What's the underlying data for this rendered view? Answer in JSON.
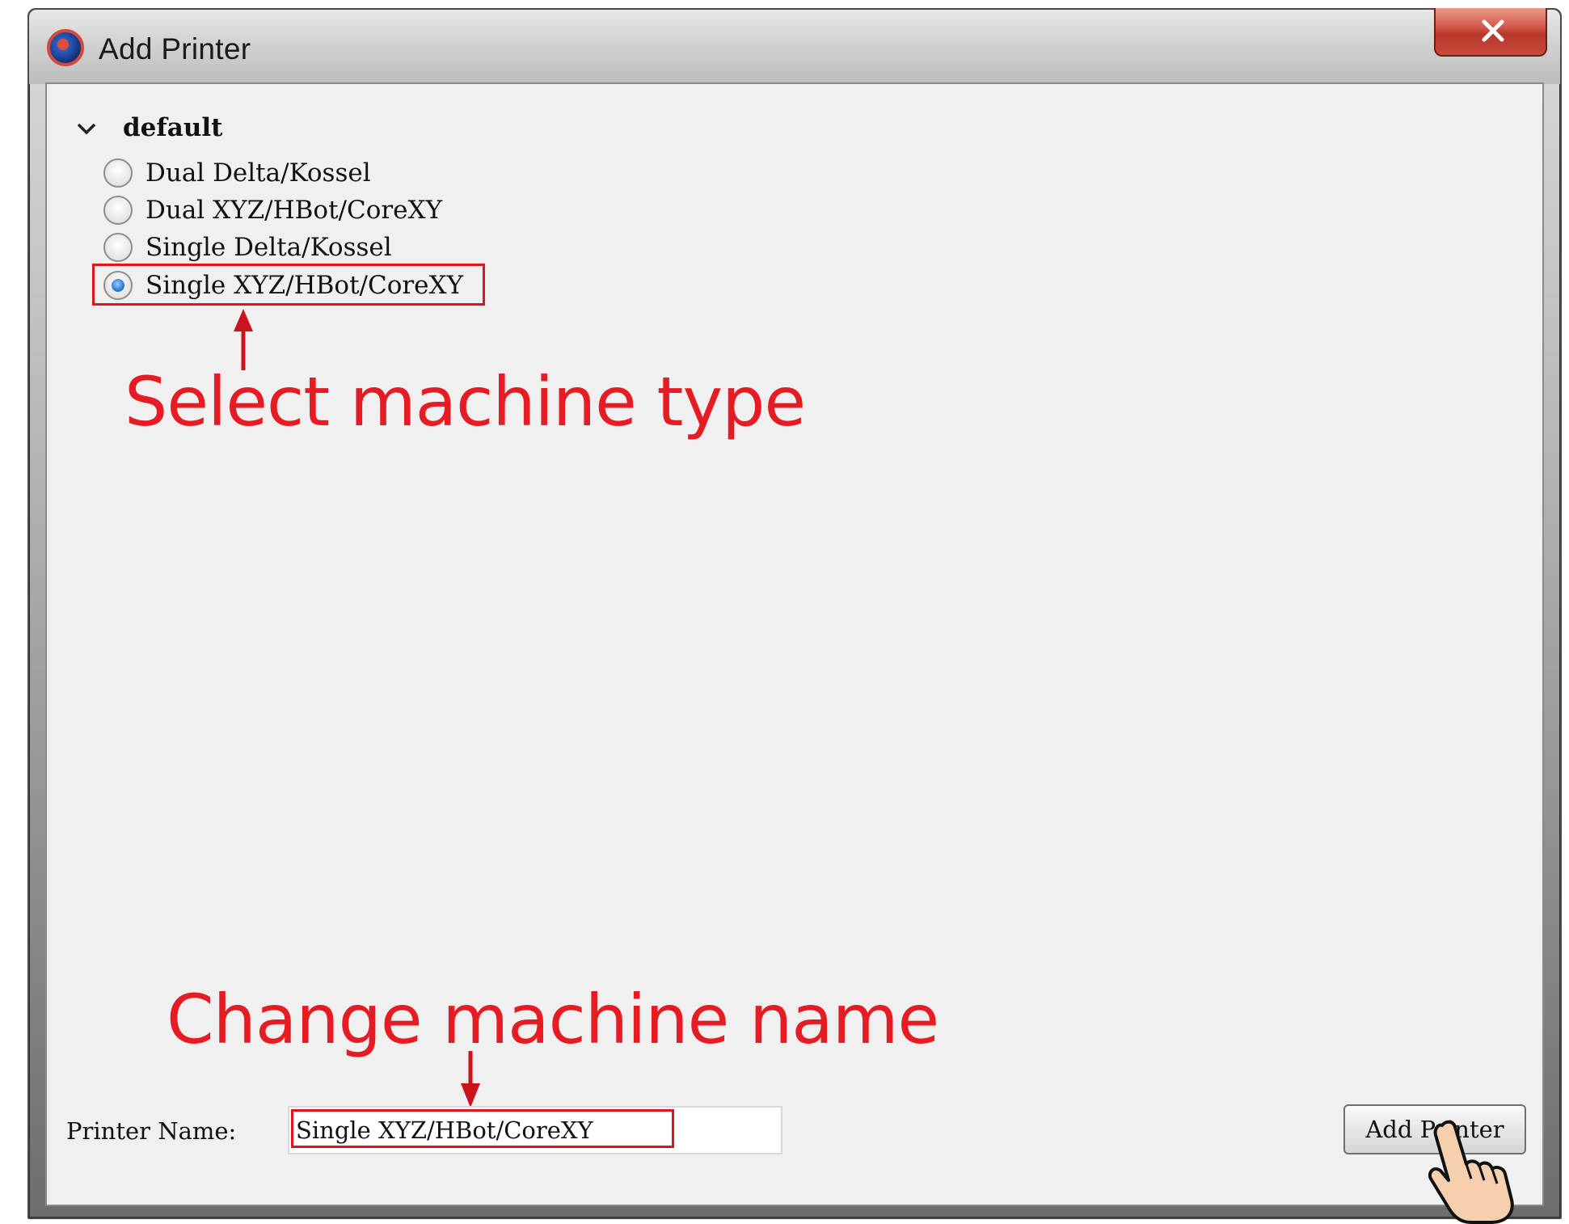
{
  "window": {
    "title": "Add Printer",
    "close_label": "X"
  },
  "tree": {
    "group_label": "default",
    "options": [
      {
        "label": "Dual Delta/Kossel",
        "checked": false
      },
      {
        "label": "Dual XYZ/HBot/CoreXY",
        "checked": false
      },
      {
        "label": "Single Delta/Kossel",
        "checked": false
      },
      {
        "label": "Single XYZ/HBot/CoreXY",
        "checked": true
      }
    ]
  },
  "annotations": {
    "select_type": "Select machine type",
    "change_name": "Change machine name",
    "color": "#e51c23"
  },
  "form": {
    "printer_name_label": "Printer Name:",
    "printer_name_value": "Single XYZ/HBot/CoreXY",
    "add_button_label": "Add Printer"
  }
}
